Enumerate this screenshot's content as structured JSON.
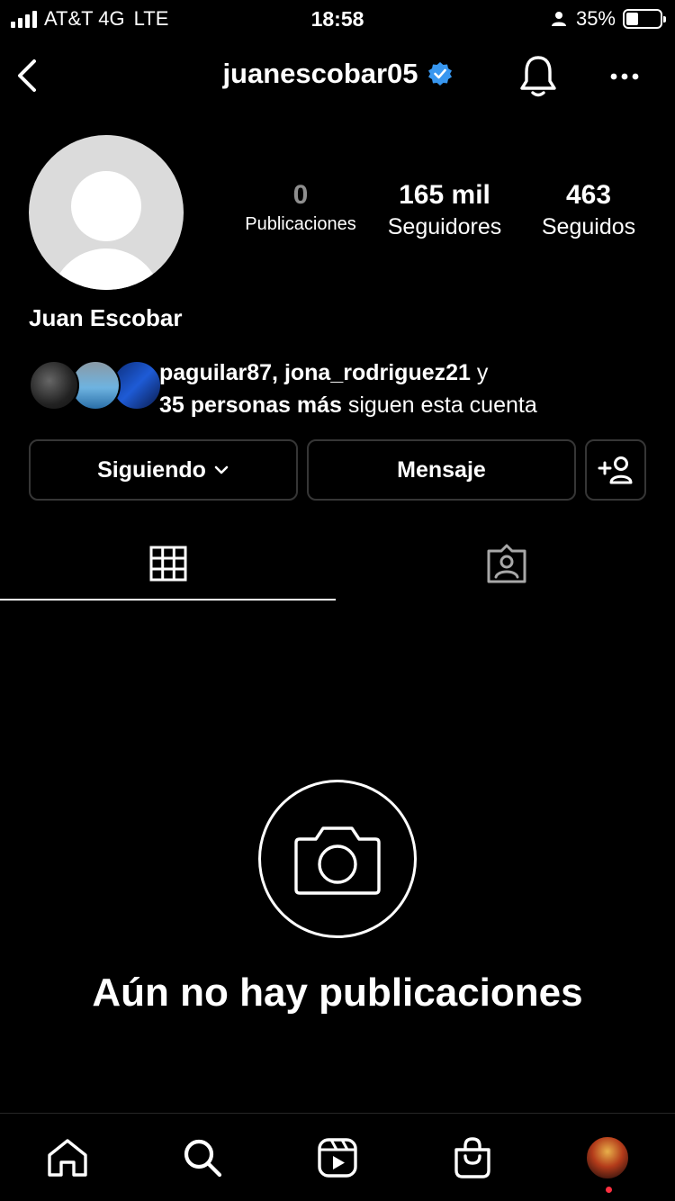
{
  "status_bar": {
    "carrier": "AT&T 4G",
    "network": "LTE",
    "time": "18:58",
    "battery": "35%",
    "battery_level": 0.35
  },
  "header": {
    "username": "juanescobar05",
    "verified_color": "#3897f0"
  },
  "profile": {
    "posts_count": "0",
    "posts_label": "Publicaciones",
    "followers_count": "165 mil",
    "followers_label": "Seguidores",
    "following_count": "463",
    "following_label": "Seguidos",
    "display_name": "Juan Escobar"
  },
  "mutuals": {
    "names": "paguilar87, jona_rodriguez21",
    "and": " y",
    "more_bold": "35 personas más",
    "suffix": " siguen esta cuenta"
  },
  "actions": {
    "following_label": "Siguiendo",
    "message_label": "Mensaje"
  },
  "tabs": {
    "active": "grid",
    "icons": [
      "grid-icon",
      "tagged-icon"
    ]
  },
  "empty_state": {
    "title": "Aún no hay publicaciones",
    "icon": "camera-icon"
  },
  "bottom_nav": {
    "items": [
      "home-icon",
      "search-icon",
      "reels-icon",
      "shop-icon",
      "profile-avatar"
    ],
    "notification_dot_color": "#ff3040"
  }
}
